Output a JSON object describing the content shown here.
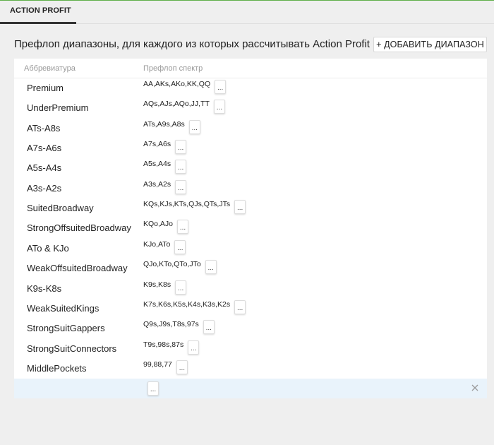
{
  "tab": {
    "label": "ACTION PROFIT"
  },
  "heading": "Префлоп диапазоны, для каждого из которых рассчитывать Action Profit",
  "add_button": "+ ДОБАВИТЬ ДИАПАЗОН",
  "table": {
    "headers": {
      "abbr": "Аббревиатура",
      "range": "Префлоп спектр"
    },
    "rows": [
      {
        "abbr": "Premium",
        "range": "AA,AKs,AKo,KK,QQ"
      },
      {
        "abbr": "UnderPremium",
        "range": "AQs,AJs,AQo,JJ,TT"
      },
      {
        "abbr": "ATs-A8s",
        "range": "ATs,A9s,A8s"
      },
      {
        "abbr": "A7s-A6s",
        "range": "A7s,A6s"
      },
      {
        "abbr": "A5s-A4s",
        "range": "A5s,A4s"
      },
      {
        "abbr": "A3s-A2s",
        "range": "A3s,A2s"
      },
      {
        "abbr": "SuitedBroadway",
        "range": "KQs,KJs,KTs,QJs,QTs,JTs"
      },
      {
        "abbr": "StrongOffsuitedBroadway",
        "range": "KQo,AJo"
      },
      {
        "abbr": "ATo & KJo",
        "range": "KJo,ATo"
      },
      {
        "abbr": "WeakOffsuitedBroadway",
        "range": "QJo,KTo,QTo,JTo"
      },
      {
        "abbr": "K9s-K8s",
        "range": "K9s,K8s"
      },
      {
        "abbr": "WeakSuitedKings",
        "range": "K7s,K6s,K5s,K4s,K3s,K2s"
      },
      {
        "abbr": "StrongSuitGappers",
        "range": "Q9s,J9s,T8s,97s"
      },
      {
        "abbr": "StrongSuitConnectors",
        "range": "T9s,98s,87s"
      },
      {
        "abbr": "MiddlePockets",
        "range": "99,88,77"
      }
    ],
    "edit_label": "..."
  },
  "icons": {
    "close": "close-icon"
  },
  "colors": {
    "accent": "#5fb04a",
    "new_row_bg": "#e9f3fb"
  }
}
